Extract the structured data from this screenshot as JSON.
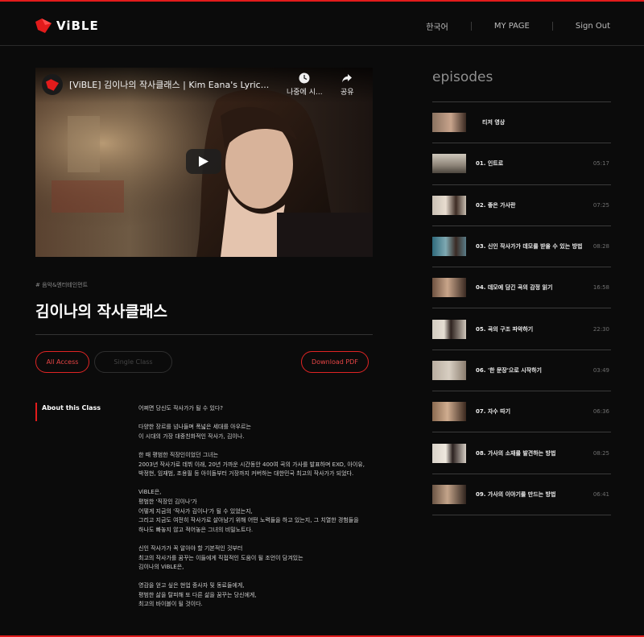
{
  "header": {
    "logo_text": "ViBLE",
    "nav": {
      "language": "한국어",
      "mypage": "MY PAGE",
      "signout": "Sign Out"
    }
  },
  "video": {
    "title": "[ViBLE] 김이나의 작사클래스 | Kim Eana's Lyric...",
    "watch_later_label": "나중에 시...",
    "share_label": "공유"
  },
  "class": {
    "category": "# 음악&엔터테인먼트",
    "title": "김이나의 작사클래스",
    "buttons": {
      "all_access": "All Access",
      "single_class": "Single Class",
      "download_pdf": "Download PDF"
    },
    "about_label": "About this Class",
    "description": [
      "어쩌면 당신도 작사가가 될 수 있다?",
      "다양한 장르를 넘나들며 폭넓은 세대를 아우르는\n이 시대의 가장 대중친화적인 작사가, 김이나.",
      "한 때 평범한 직장인이었던 그녀는\n2003년 작사가로 데뷔 이래, 20년 가까운 시간동안 400여 곡의 가사를 발표하며 EXO, 아이유,\n박정현, 임재범, 조용필 등 아이돌부터 거장까지 커버하는 대한민국 최고의 작사가가 되었다.",
      "ViBLE은,\n평범한 '직장인 김이나'가\n어떻게 지금의 '작사가 김이나'가 될 수 있었는지,\n그리고 지금도 여전히 작사가로 살아남기 위해 어떤 노력들을 하고 있는지, 그 치열한 경험들을\n하나도 빠놓지 않고 적어놓은 그녀의 비밀노트다.",
      "신인 작사가가 꼭 알아야 할 기본적인 것부터\n최고의 작사가를 꿈꾸는 이들에게 직접적인 도움이 될 조언이 담겨있는\n김이나의 ViBLE은,",
      "영감을 얻고 싶은 현업 종사자 및 동료들에게,\n평범한 삶을 탈피해 또 다른 삶을 꿈꾸는 당신에게,\n최고의 바이블이 될 것이다."
    ]
  },
  "episodes": {
    "heading": "episodes",
    "items": [
      {
        "title": "티저 영상",
        "time": ""
      },
      {
        "title": "01. 인트로",
        "time": "05:17"
      },
      {
        "title": "02. 좋은 가사란",
        "time": "07:25"
      },
      {
        "title": "03. 신인 작사가가 데모를 받을 수 있는 방법",
        "time": "08:28"
      },
      {
        "title": "04. 데모에 담긴 곡의 감정 읽기",
        "time": "16:58"
      },
      {
        "title": "05. 곡의 구조 파악하기",
        "time": "22:30"
      },
      {
        "title": "06. '한 문장'으로 시작하기",
        "time": "03:49"
      },
      {
        "title": "07. 자수 따기",
        "time": "06:36"
      },
      {
        "title": "08. 가사의 소재를 발견하는 방법",
        "time": "08:25"
      },
      {
        "title": "09. 가사의 이야기를 만드는 방법",
        "time": "06:41"
      }
    ]
  },
  "colors": {
    "accent": "#e21b1b",
    "background": "#0b0b0b"
  }
}
